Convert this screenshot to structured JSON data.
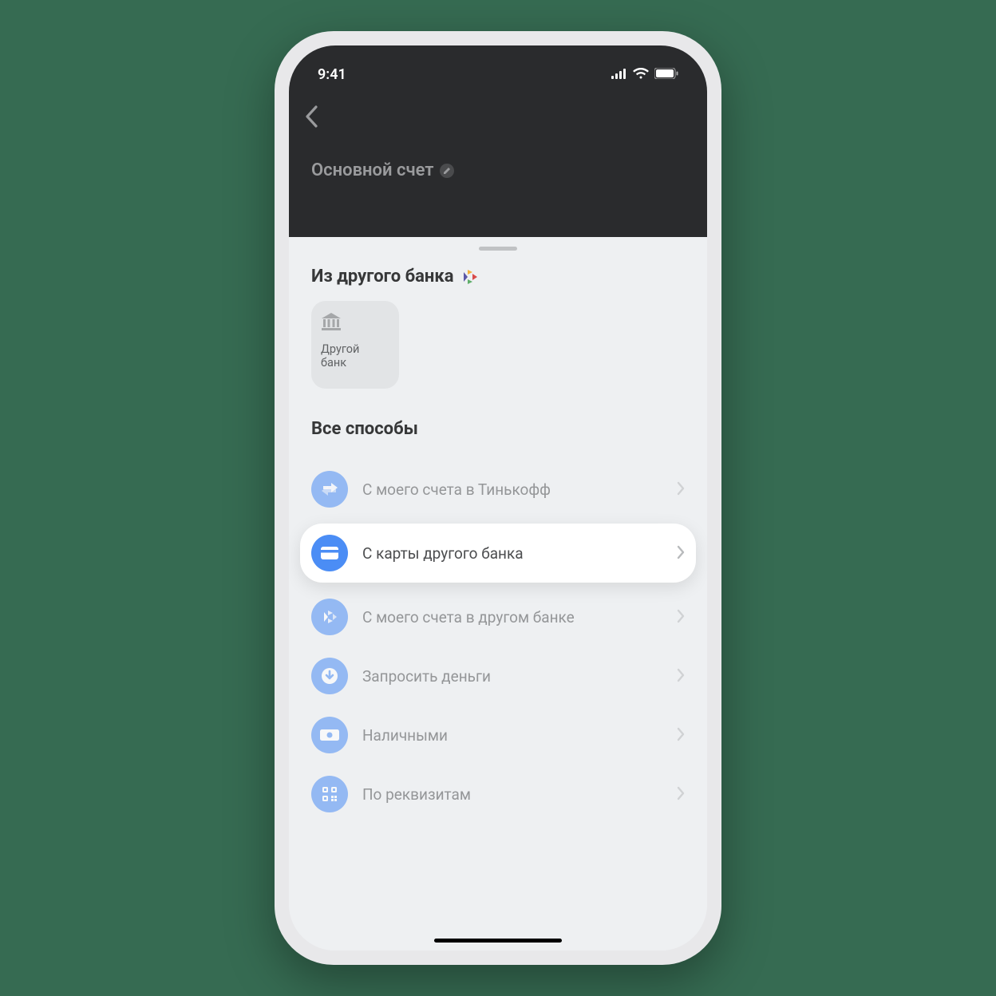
{
  "status": {
    "time": "9:41"
  },
  "header": {
    "account_title": "Основной счет"
  },
  "sheet": {
    "from_other_bank_title": "Из другого банка",
    "other_bank_card": {
      "line1": "Другой",
      "line2": "банк"
    },
    "all_methods_title": "Все способы",
    "methods": [
      {
        "label": "С моего счета в Тинькофф",
        "icon": "arrows-exchange"
      },
      {
        "label": "С карты другого банка",
        "icon": "card",
        "highlight": true
      },
      {
        "label": "С моего счета в другом банке",
        "icon": "sbp"
      },
      {
        "label": "Запросить деньги",
        "icon": "download"
      },
      {
        "label": "Наличными",
        "icon": "cash"
      },
      {
        "label": "По реквизитам",
        "icon": "qr"
      }
    ]
  }
}
